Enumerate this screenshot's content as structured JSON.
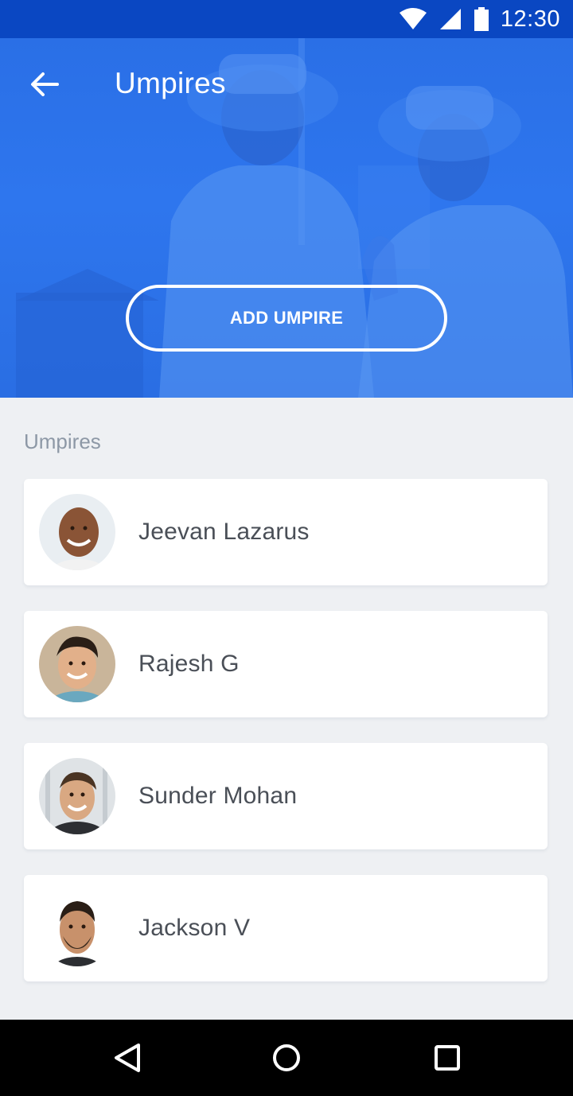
{
  "status_bar": {
    "time": "12:30"
  },
  "header": {
    "title": "Umpires"
  },
  "hero": {
    "add_button_label": "ADD UMPIRE"
  },
  "list": {
    "section_label": "Umpires",
    "umpires": [
      {
        "name": "Jeevan Lazarus"
      },
      {
        "name": "Rajesh G"
      },
      {
        "name": "Sunder Mohan"
      },
      {
        "name": "Jackson V"
      }
    ]
  },
  "colors": {
    "status_bar": "#0a47c2",
    "hero_blue": "#2e76ee",
    "background": "#eef0f3",
    "name_text": "#4a4f57",
    "section_label": "#8d98a6"
  },
  "icons": {
    "back": "arrow-left-icon",
    "wifi": "wifi-icon",
    "signal": "signal-icon",
    "battery": "battery-icon",
    "nav_back": "triangle-back-icon",
    "nav_home": "circle-home-icon",
    "nav_recents": "square-recents-icon"
  }
}
